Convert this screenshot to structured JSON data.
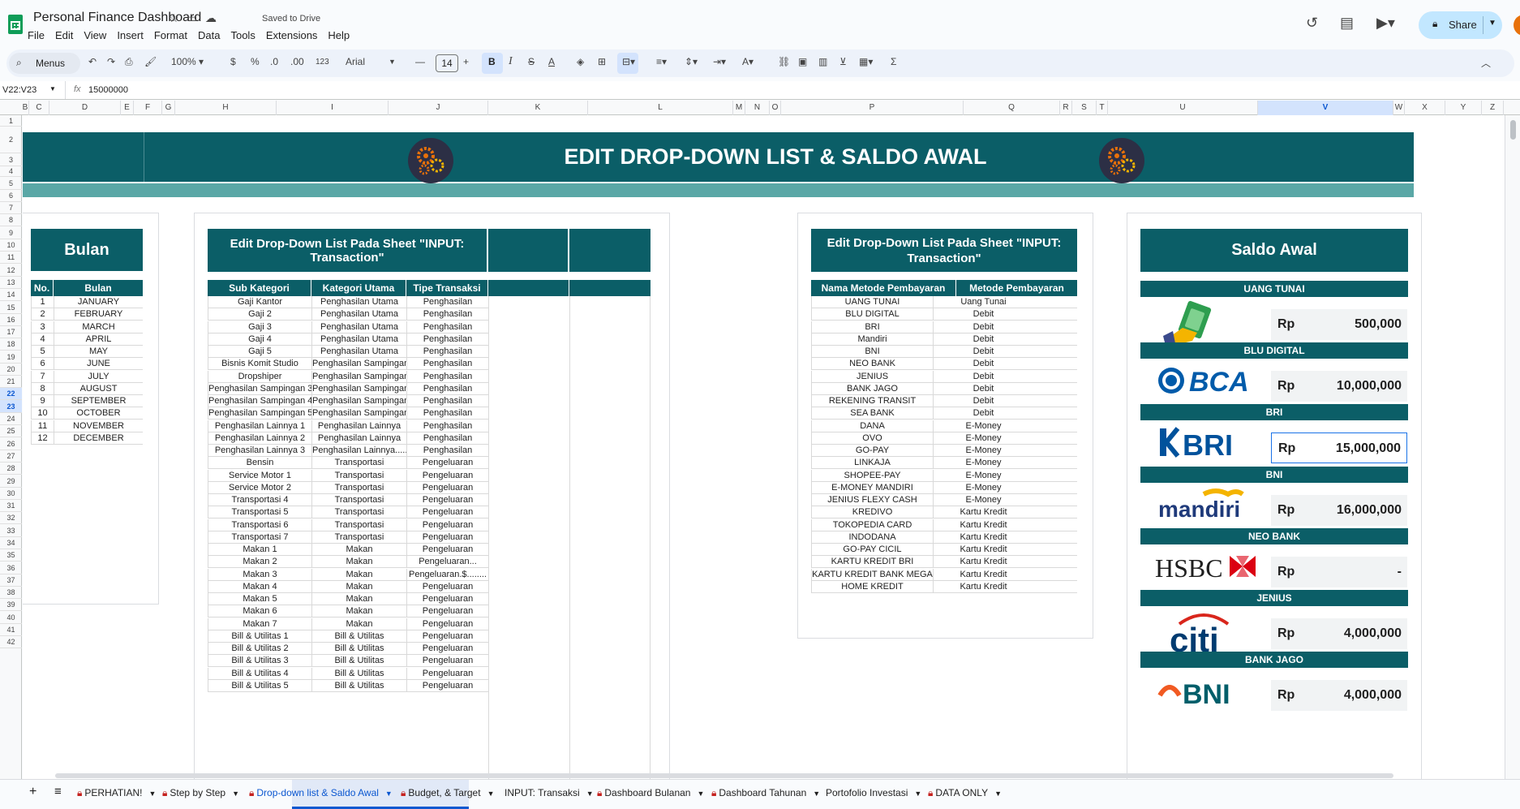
{
  "app": {
    "doc_title": "Personal Finance Dashboard",
    "saved_status": "Saved to Drive",
    "menu": [
      "File",
      "Edit",
      "View",
      "Insert",
      "Format",
      "Data",
      "Tools",
      "Extensions",
      "Help"
    ],
    "share_label": "Share"
  },
  "toolbar": {
    "menus_label": "Menus",
    "zoom": "100%",
    "currency": "$",
    "percent": "%",
    "dec_decrease": ".0",
    "dec_increase": ".00",
    "format_123": "123",
    "font": "Arial",
    "font_size": "14"
  },
  "formula_bar": {
    "cell_ref": "V22:V23",
    "fx": "fx",
    "value": "15000000"
  },
  "columns": [
    "B",
    "C",
    "D",
    "E",
    "F",
    "G",
    "H",
    "I",
    "J",
    "K",
    "L",
    "M",
    "N",
    "O",
    "P",
    "Q",
    "R",
    "S",
    "T",
    "U",
    "V",
    "W",
    "X",
    "Y",
    "Z"
  ],
  "selected_column": "V",
  "rows": [
    "1",
    "2",
    "3",
    "4",
    "5",
    "6",
    "7",
    "8",
    "9",
    "10",
    "11",
    "12",
    "13",
    "14",
    "15",
    "16",
    "17",
    "18",
    "19",
    "20",
    "21",
    "22",
    "23",
    "24",
    "25",
    "26",
    "27",
    "28",
    "29",
    "30",
    "31",
    "32",
    "33",
    "34",
    "35",
    "36",
    "37",
    "38",
    "39",
    "40",
    "41",
    "42"
  ],
  "selected_rows": [
    "22",
    "23"
  ],
  "banner": {
    "title": "EDIT DROP-DOWN LIST & SALDO AWAL",
    "color": "#0b5e67"
  },
  "bulan": {
    "title": "Bulan",
    "headers": [
      "No.",
      "Bulan"
    ],
    "rows": [
      [
        "1",
        "JANUARY"
      ],
      [
        "2",
        "FEBRUARY"
      ],
      [
        "3",
        "MARCH"
      ],
      [
        "4",
        "APRIL"
      ],
      [
        "5",
        "MAY"
      ],
      [
        "6",
        "JUNE"
      ],
      [
        "7",
        "JULY"
      ],
      [
        "8",
        "AUGUST"
      ],
      [
        "9",
        "SEPTEMBER"
      ],
      [
        "10",
        "OCTOBER"
      ],
      [
        "11",
        "NOVEMBER"
      ],
      [
        "12",
        "DECEMBER"
      ]
    ]
  },
  "kategori": {
    "title": "Edit Drop-Down List Pada Sheet \"INPUT: Transaction\"",
    "headers": [
      "Sub Kategori",
      "Kategori Utama",
      "Tipe Transaksi"
    ],
    "rows": [
      [
        "Gaji Kantor",
        "Penghasilan Utama",
        "Penghasilan"
      ],
      [
        "Gaji 2",
        "Penghasilan Utama",
        "Penghasilan"
      ],
      [
        "Gaji 3",
        "Penghasilan Utama",
        "Penghasilan"
      ],
      [
        "Gaji 4",
        "Penghasilan Utama",
        "Penghasilan"
      ],
      [
        "Gaji 5",
        "Penghasilan Utama",
        "Penghasilan"
      ],
      [
        "Bisnis Komit Studio",
        "Penghasilan Sampingan",
        "Penghasilan"
      ],
      [
        "Dropshiper",
        "Penghasilan Sampingan",
        "Penghasilan"
      ],
      [
        "Penghasilan Sampingan 3",
        "Penghasilan Sampingan",
        "Penghasilan"
      ],
      [
        "Penghasilan Sampingan 4",
        "Penghasilan Sampingan",
        "Penghasilan"
      ],
      [
        "Penghasilan Sampingan 5",
        "Penghasilan Sampingan",
        "Penghasilan"
      ],
      [
        "Penghasilan Lainnya 1",
        "Penghasilan Lainnya",
        "Penghasilan"
      ],
      [
        "Penghasilan Lainnya 2",
        "Penghasilan Lainnya",
        "Penghasilan"
      ],
      [
        "Penghasilan Lainnya 3",
        "Penghasilan Lainnya........",
        "Penghasilan"
      ],
      [
        "Bensin",
        "Transportasi",
        "Pengeluaran"
      ],
      [
        "Service Motor 1",
        "Transportasi",
        "Pengeluaran"
      ],
      [
        "Service Motor 2",
        "Transportasi",
        "Pengeluaran"
      ],
      [
        "Transportasi 4",
        "Transportasi",
        "Pengeluaran"
      ],
      [
        "Transportasi 5",
        "Transportasi",
        "Pengeluaran"
      ],
      [
        "Transportasi 6",
        "Transportasi",
        "Pengeluaran"
      ],
      [
        "Transportasi 7",
        "Transportasi",
        "Pengeluaran"
      ],
      [
        "Makan 1",
        "Makan",
        "Pengeluaran"
      ],
      [
        "Makan 2",
        "Makan",
        "Pengeluaran..."
      ],
      [
        "Makan 3",
        "Makan",
        "Pengeluaran.$........"
      ],
      [
        "Makan 4",
        "Makan",
        "Pengeluaran"
      ],
      [
        "Makan 5",
        "Makan",
        "Pengeluaran"
      ],
      [
        "Makan 6",
        "Makan",
        "Pengeluaran"
      ],
      [
        "Makan 7",
        "Makan",
        "Pengeluaran"
      ],
      [
        "Bill & Utilitas 1",
        "Bill & Utilitas",
        "Pengeluaran"
      ],
      [
        "Bill & Utilitas 2",
        "Bill & Utilitas",
        "Pengeluaran"
      ],
      [
        "Bill & Utilitas 3",
        "Bill & Utilitas",
        "Pengeluaran"
      ],
      [
        "Bill & Utilitas 4",
        "Bill & Utilitas",
        "Pengeluaran"
      ],
      [
        "Bill & Utilitas 5",
        "Bill & Utilitas",
        "Pengeluaran"
      ]
    ]
  },
  "metode": {
    "title": "Edit Drop-Down List Pada Sheet \"INPUT: Transaction\"",
    "headers": [
      "Nama Metode Pembayaran",
      "Metode Pembayaran"
    ],
    "rows": [
      [
        "UANG TUNAI",
        "Uang Tunai"
      ],
      [
        "BLU DIGITAL",
        "Debit"
      ],
      [
        "BRI",
        "Debit"
      ],
      [
        "Mandiri",
        "Debit"
      ],
      [
        "BNI",
        "Debit"
      ],
      [
        "NEO BANK",
        "Debit"
      ],
      [
        "JENIUS",
        "Debit"
      ],
      [
        "BANK JAGO",
        "Debit"
      ],
      [
        "REKENING TRANSIT",
        "Debit"
      ],
      [
        "SEA BANK",
        "Debit"
      ],
      [
        "DANA",
        "E-Money"
      ],
      [
        "OVO",
        "E-Money"
      ],
      [
        "GO-PAY",
        "E-Money"
      ],
      [
        "LINKAJA",
        "E-Money"
      ],
      [
        "SHOPEE-PAY",
        "E-Money"
      ],
      [
        "E-MONEY MANDIRI",
        "E-Money"
      ],
      [
        "JENIUS FLEXY CASH",
        "E-Money"
      ],
      [
        "KREDIVO",
        "Kartu Kredit"
      ],
      [
        "TOKOPEDIA CARD",
        "Kartu Kredit"
      ],
      [
        "INDODANA",
        "Kartu Kredit"
      ],
      [
        "GO-PAY CICIL",
        "Kartu Kredit"
      ],
      [
        "KARTU KREDIT BRI",
        "Kartu Kredit"
      ],
      [
        "KARTU KREDIT BANK MEGA",
        "Kartu Kredit"
      ],
      [
        "HOME KREDIT",
        "Kartu Kredit"
      ]
    ]
  },
  "saldo": {
    "title": "Saldo Awal",
    "currency": "Rp",
    "accounts": [
      {
        "name": "UANG TUNAI",
        "logo": "cash-hand-icon",
        "amount": "500,000"
      },
      {
        "name": "BLU DIGITAL",
        "logo_text": "BCA",
        "amount": "10,000,000"
      },
      {
        "name": "BRI",
        "logo_text": "BRI",
        "amount": "15,000,000"
      },
      {
        "name": "BNI",
        "logo_text": "mandiri",
        "amount": "16,000,000"
      },
      {
        "name": "NEO BANK",
        "logo_text": "HSBC",
        "amount": "-"
      },
      {
        "name": "JENIUS",
        "logo_text": "citi",
        "amount": "4,000,000"
      },
      {
        "name": "BANK JAGO",
        "logo_text": "BNI",
        "amount": "4,000,000"
      }
    ]
  },
  "sheet_tabs": [
    {
      "label": "PERHATIAN!",
      "locked": true
    },
    {
      "label": "Step by Step",
      "locked": true
    },
    {
      "label": "Drop-down list & Saldo Awal",
      "locked": true,
      "active": true
    },
    {
      "label": "Budget, & Target",
      "locked": true
    },
    {
      "label": "INPUT: Transaksi",
      "locked": false
    },
    {
      "label": "Dashboard Bulanan",
      "locked": true
    },
    {
      "label": "Dashboard Tahunan",
      "locked": true
    },
    {
      "label": "Portofolio Investasi",
      "locked": false
    },
    {
      "label": "DATA ONLY",
      "locked": true
    }
  ],
  "colors": {
    "teal": "#0b5e67",
    "teal_light": "#5aa7a6",
    "accent": "#0b57d0"
  }
}
